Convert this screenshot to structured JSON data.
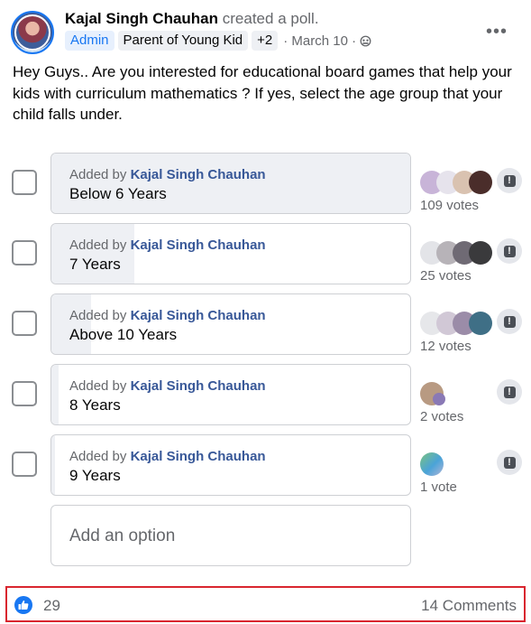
{
  "post": {
    "author": "Kajal Singh Chauhan",
    "action": "created a poll.",
    "badges": [
      "Admin",
      "Parent of Young Kid",
      "+2"
    ],
    "date": "· March 10 ·",
    "more_label": "•••",
    "text": "Hey Guys.. Are you interested for educational board games that help your kids with curriculum mathematics ? If yes, select the age group that your child falls under."
  },
  "poll": {
    "added_by_prefix": "Added by",
    "options": [
      {
        "added_by": "Kajal Singh Chauhan",
        "label": "Below 6 Years",
        "votes": "109 votes",
        "fill_pct": 100
      },
      {
        "added_by": "Kajal Singh Chauhan",
        "label": "7 Years",
        "votes": "25 votes",
        "fill_pct": 23
      },
      {
        "added_by": "Kajal Singh Chauhan",
        "label": "Above 10 Years",
        "votes": "12 votes",
        "fill_pct": 11
      },
      {
        "added_by": "Kajal Singh Chauhan",
        "label": "8 Years",
        "votes": "2 votes",
        "fill_pct": 2
      },
      {
        "added_by": "Kajal Singh Chauhan",
        "label": "9 Years",
        "votes": "1 vote",
        "fill_pct": 1
      }
    ],
    "add_option_placeholder": "Add an option"
  },
  "footer": {
    "like_count": "29",
    "comments": "14 Comments"
  },
  "colors": {
    "accent": "#1877f2",
    "link": "#385898",
    "highlight_border": "#d9262f"
  }
}
